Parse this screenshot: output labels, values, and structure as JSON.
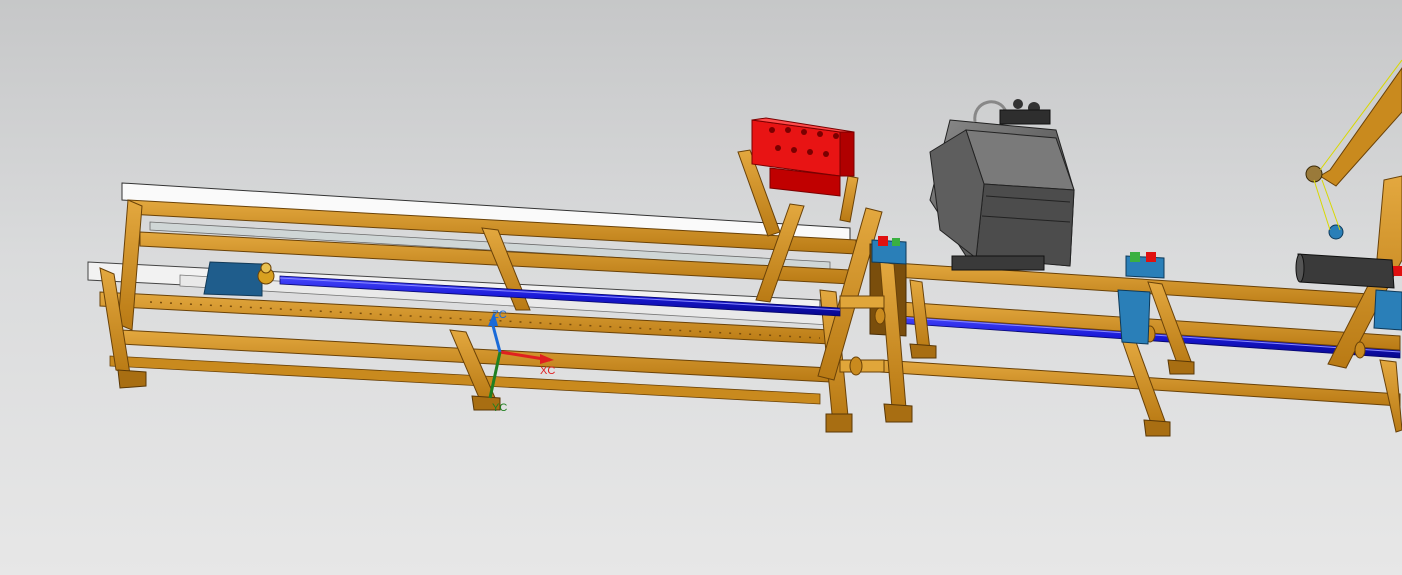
{
  "viewport": {
    "background_top": "#c6c7c8",
    "background_bottom": "#e7e7e7"
  },
  "colors": {
    "frame": "#c98a1e",
    "frame_dark": "#8a5a10",
    "frame_light": "#e0a63a",
    "pipe": "#1a1ad8",
    "pipe_dark": "#0b0b8a",
    "rail": "#f4f4f4",
    "motor_box": "#e01010",
    "gearbox": "#5a5a5a",
    "clamp": "#2a7fb8",
    "axis_x": "#e02020",
    "axis_y": "#208020",
    "axis_z": "#1a6ad8"
  },
  "axes": {
    "x_label": "XC",
    "y_label": "YC",
    "z_label": "ZC"
  },
  "model": {
    "components": [
      "frame-left",
      "frame-right",
      "rail-track",
      "pipe",
      "red-junction-box",
      "grey-gearbox",
      "clamp-assemblies",
      "hoist-arm"
    ]
  }
}
